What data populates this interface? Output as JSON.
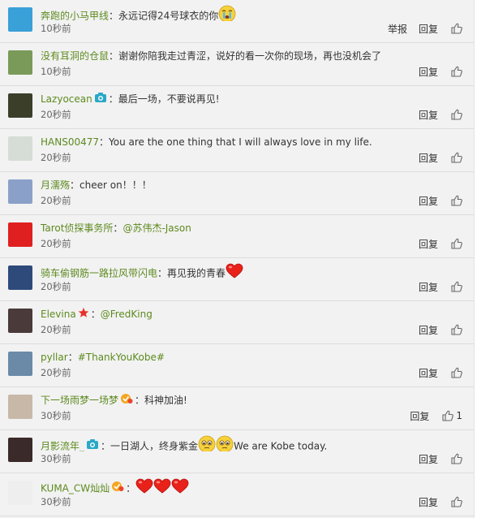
{
  "comments": [
    {
      "user": "奔跑的小马甲线",
      "text": "永远记得24号球衣的你",
      "emoji": "cry",
      "time": "10秒前",
      "report": "举报",
      "reply": "回复",
      "likes": "",
      "avatar": "#3aa0d8"
    },
    {
      "user": "没有耳洞的仓鼠",
      "text": "谢谢你陪我走过青涩，说好的看一次你的现场，再也没机会了",
      "time": "10秒前",
      "reply": "回复",
      "likes": "",
      "avatar": "#7a9a5a"
    },
    {
      "user": "Lazyocean",
      "badge": "camera",
      "text": "最后一场，不要说再见!",
      "time": "20秒前",
      "reply": "回复",
      "likes": "",
      "avatar": "#3b3f2a"
    },
    {
      "user": "HANS00477",
      "text": "You are the one thing that I will always love in my life.",
      "time": "20秒前",
      "reply": "回复",
      "likes": "",
      "avatar": "#d6dcd6"
    },
    {
      "user": "月濡殇",
      "text": "cheer on！！！",
      "time": "20秒前",
      "reply": "回复",
      "likes": "",
      "avatar": "#8aa0c8"
    },
    {
      "user": "Tarot侦探事务所",
      "mention": "@苏伟杰-Jason",
      "time": "20秒前",
      "reply": "回复",
      "likes": "",
      "avatar": "#e02020"
    },
    {
      "user": "骑车偷钢筋一路拉风带闪电",
      "text": "再见我的青春",
      "emoji": "heart",
      "time": "20秒前",
      "reply": "回复",
      "likes": "",
      "avatar": "#2d4a7a"
    },
    {
      "user": "Elevina",
      "badge": "star",
      "mention": "@FredKing",
      "time": "20秒前",
      "reply": "回复",
      "likes": "",
      "avatar": "#4a3a3a"
    },
    {
      "user": "pyllar",
      "tag": "#ThankYouKobe#",
      "time": "20秒前",
      "reply": "回复",
      "likes": "",
      "avatar": "#6a8aa8"
    },
    {
      "user": "下一场雨梦一场梦",
      "badge": "vip",
      "text": "科神加油!",
      "time": "30秒前",
      "reply": "回复",
      "likes": "1",
      "avatar": "#c8b8a8"
    },
    {
      "user": "月影流年_",
      "badge": "camera",
      "text": "一日湖人，终身紫金",
      "emoji": "smile2",
      "text2": "We are Kobe today.",
      "time": "30秒前",
      "reply": "回复",
      "likes": "",
      "avatar": "#3a2a2a"
    },
    {
      "user": "KUMA_CW灿灿",
      "badge": "vip",
      "emoji": "heart3",
      "time": "30秒前",
      "reply": "回复",
      "likes": "",
      "avatar": "#eeeeee"
    }
  ]
}
